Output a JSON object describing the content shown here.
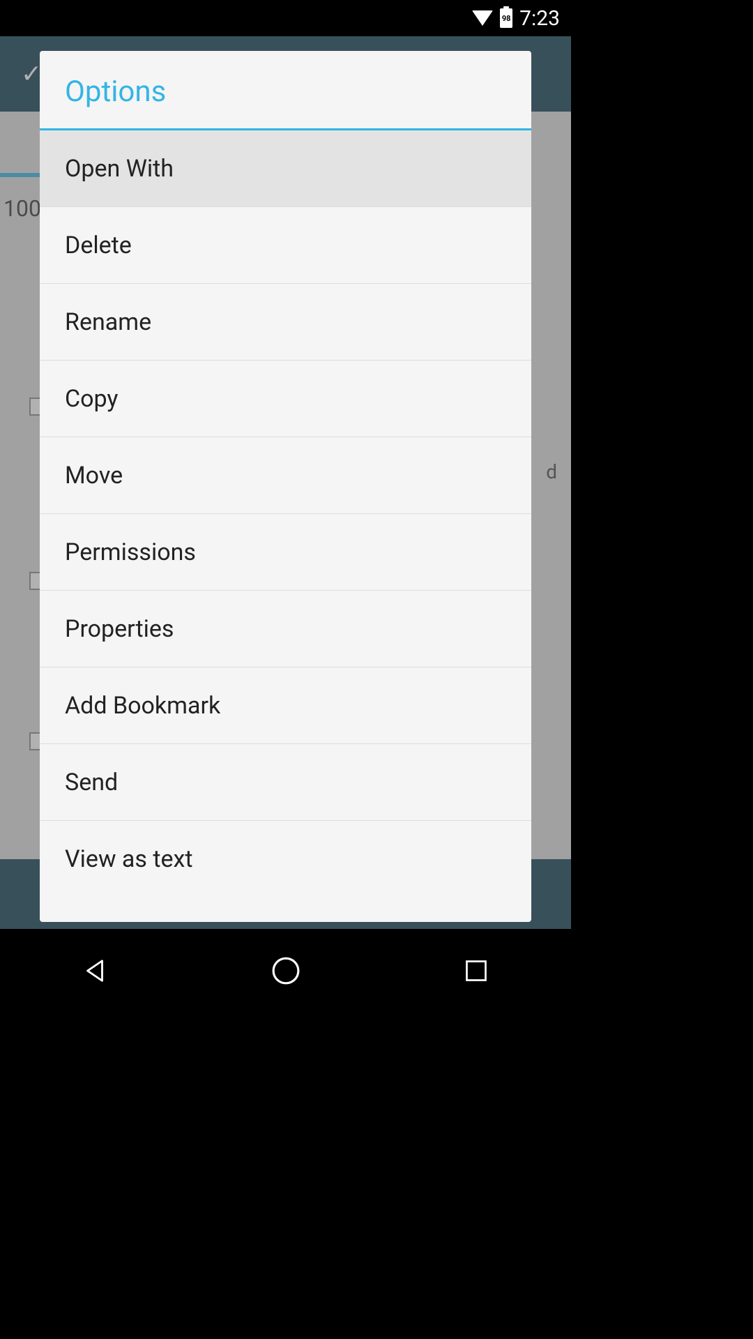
{
  "status_bar": {
    "battery_level": "98",
    "time": "7:23"
  },
  "background": {
    "partial_text": "100",
    "row_letter": "d"
  },
  "dialog": {
    "title": "Options",
    "items": [
      {
        "label": "Open With",
        "highlighted": true
      },
      {
        "label": "Delete",
        "highlighted": false
      },
      {
        "label": "Rename",
        "highlighted": false
      },
      {
        "label": "Copy",
        "highlighted": false
      },
      {
        "label": "Move",
        "highlighted": false
      },
      {
        "label": "Permissions",
        "highlighted": false
      },
      {
        "label": "Properties",
        "highlighted": false
      },
      {
        "label": "Add Bookmark",
        "highlighted": false
      },
      {
        "label": "Send",
        "highlighted": false
      },
      {
        "label": "View as text",
        "highlighted": false
      }
    ]
  }
}
